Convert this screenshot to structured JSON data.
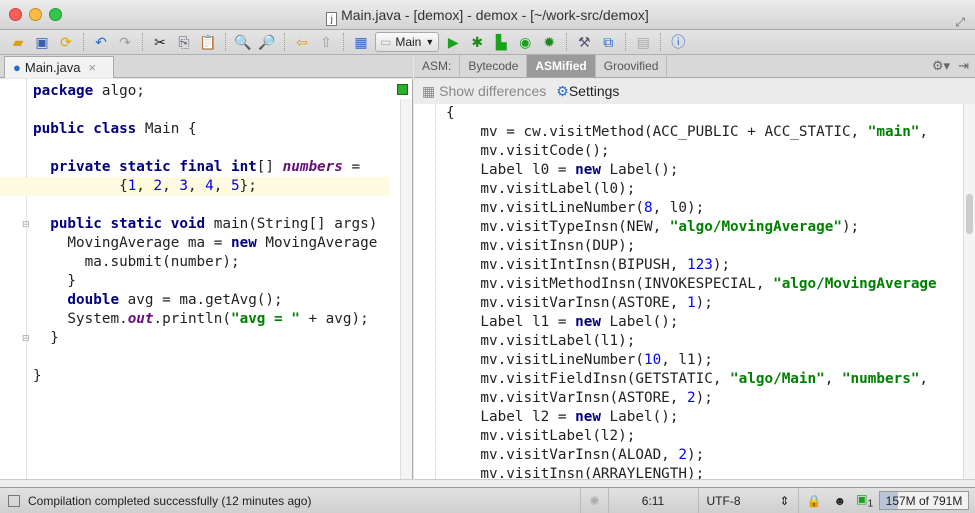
{
  "window": {
    "title": "Main.java - [demox] - demox - [~/work-src/demox]",
    "file_icon": "java-file-icon"
  },
  "toolbar": {
    "run_config": "Main"
  },
  "editor": {
    "tab_label": "Main.java",
    "close": "×",
    "lines": [
      [
        [
          "package",
          "kw"
        ],
        [
          " algo;",
          ""
        ]
      ],
      [],
      [
        [
          "public class",
          "kw"
        ],
        [
          " Main {",
          ""
        ]
      ],
      [],
      [
        [
          "  private static final int",
          "kw"
        ],
        [
          "[] ",
          ""
        ],
        [
          "numbers",
          "fld"
        ],
        [
          " =",
          ""
        ]
      ],
      [
        [
          "          {",
          ""
        ],
        [
          "1",
          "num"
        ],
        [
          ", ",
          ""
        ],
        [
          "2",
          "num"
        ],
        [
          ", ",
          ""
        ],
        [
          "3",
          "num"
        ],
        [
          ", ",
          ""
        ],
        [
          "4",
          "num"
        ],
        [
          ", ",
          ""
        ],
        [
          "5",
          "num"
        ],
        [
          "};",
          ""
        ]
      ],
      [],
      [
        [
          "  public static void",
          "kw"
        ],
        [
          " main(String[] args)",
          ""
        ]
      ],
      [
        [
          "    MovingAverage ma = ",
          ""
        ],
        [
          "new",
          "kw"
        ],
        [
          " MovingAverage",
          ""
        ]
      ],
      [
        [
          "      ma.submit(number);",
          ""
        ]
      ],
      [
        [
          "    }",
          ""
        ]
      ],
      [
        [
          "    double",
          "kw"
        ],
        [
          " avg = ma.getAvg();",
          ""
        ]
      ],
      [
        [
          "    System.",
          ""
        ],
        [
          "out",
          "fld"
        ],
        [
          ".println(",
          ""
        ],
        [
          "\"avg = \"",
          "str"
        ],
        [
          " + avg);",
          ""
        ]
      ],
      [
        [
          "  }",
          ""
        ]
      ],
      [],
      [
        [
          "}",
          ""
        ]
      ]
    ]
  },
  "asm": {
    "label": "ASM:",
    "tabs": [
      "Bytecode",
      "ASMified",
      "Groovified"
    ],
    "active_tab": "ASMified",
    "show_differences": "Show differences",
    "settings": "Settings",
    "lines": [
      [
        [
          "{",
          ""
        ]
      ],
      [
        [
          "    mv = cw.visitMethod(ACC_PUBLIC + ACC_STATIC, ",
          ""
        ],
        [
          "\"main\"",
          "str"
        ],
        [
          ",",
          ""
        ]
      ],
      [
        [
          "    mv.visitCode();",
          ""
        ]
      ],
      [
        [
          "    Label l0 = ",
          ""
        ],
        [
          "new",
          "kw"
        ],
        [
          " Label();",
          ""
        ]
      ],
      [
        [
          "    mv.visitLabel(l0);",
          ""
        ]
      ],
      [
        [
          "    mv.visitLineNumber(",
          ""
        ],
        [
          "8",
          "num"
        ],
        [
          ", l0);",
          ""
        ]
      ],
      [
        [
          "    mv.visitTypeInsn(NEW, ",
          ""
        ],
        [
          "\"algo/MovingAverage\"",
          "str"
        ],
        [
          ");",
          ""
        ]
      ],
      [
        [
          "    mv.visitInsn(DUP);",
          ""
        ]
      ],
      [
        [
          "    mv.visitIntInsn(BIPUSH, ",
          ""
        ],
        [
          "123",
          "num"
        ],
        [
          ");",
          ""
        ]
      ],
      [
        [
          "    mv.visitMethodInsn(INVOKESPECIAL, ",
          ""
        ],
        [
          "\"algo/MovingAverage",
          "str"
        ]
      ],
      [
        [
          "    mv.visitVarInsn(ASTORE, ",
          ""
        ],
        [
          "1",
          "num"
        ],
        [
          ");",
          ""
        ]
      ],
      [
        [
          "    Label l1 = ",
          ""
        ],
        [
          "new",
          "kw"
        ],
        [
          " Label();",
          ""
        ]
      ],
      [
        [
          "    mv.visitLabel(l1);",
          ""
        ]
      ],
      [
        [
          "    mv.visitLineNumber(",
          ""
        ],
        [
          "10",
          "num"
        ],
        [
          ", l1);",
          ""
        ]
      ],
      [
        [
          "    mv.visitFieldInsn(GETSTATIC, ",
          ""
        ],
        [
          "\"algo/Main\"",
          "str"
        ],
        [
          ", ",
          ""
        ],
        [
          "\"numbers\"",
          "str"
        ],
        [
          ",",
          ""
        ]
      ],
      [
        [
          "    mv.visitVarInsn(ASTORE, ",
          ""
        ],
        [
          "2",
          "num"
        ],
        [
          ");",
          ""
        ]
      ],
      [
        [
          "    Label l2 = ",
          ""
        ],
        [
          "new",
          "kw"
        ],
        [
          " Label();",
          ""
        ]
      ],
      [
        [
          "    mv.visitLabel(l2);",
          ""
        ]
      ],
      [
        [
          "    mv.visitVarInsn(ALOAD, ",
          ""
        ],
        [
          "2",
          "num"
        ],
        [
          ");",
          ""
        ]
      ],
      [
        [
          "    mv.visitInsn(ARRAYLENGTH);",
          ""
        ]
      ]
    ]
  },
  "status": {
    "message": "Compilation completed successfully (12 minutes ago)",
    "position": "6:11",
    "encoding": "UTF-8",
    "notifications": "1",
    "memory": "157M of 791M",
    "memory_used_fraction": 0.2
  }
}
